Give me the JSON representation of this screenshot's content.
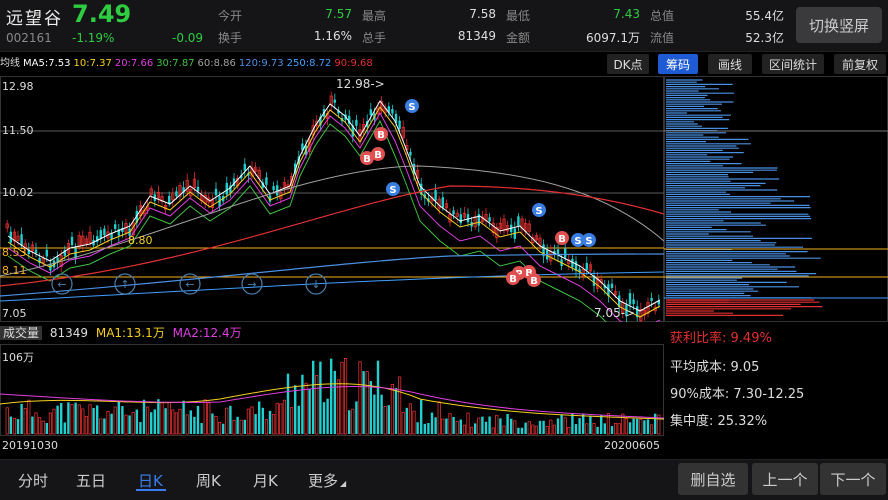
{
  "stock": {
    "name": "远望谷",
    "price": "7.49",
    "code": "002161",
    "change_pct": "-1.19%",
    "change": "-0.09"
  },
  "quote": [
    {
      "label": "今开",
      "value": "7.57",
      "green": true
    },
    {
      "label": "最高",
      "value": "7.58",
      "green": false
    },
    {
      "label": "最低",
      "value": "7.43",
      "green": true
    },
    {
      "label": "总值",
      "value": "55.4亿",
      "green": false
    },
    {
      "label": "换手",
      "value": "1.16%",
      "green": false
    },
    {
      "label": "总手",
      "value": "81349",
      "green": false
    },
    {
      "label": "金额",
      "value": "6097.1万",
      "green": false
    },
    {
      "label": "流值",
      "value": "52.3亿",
      "green": false
    }
  ],
  "switch_label": "切换竖屏",
  "ma": {
    "title": "均线",
    "items": [
      {
        "text": "MA5:7.53",
        "color": "#ffffff"
      },
      {
        "text": "10:7.37",
        "color": "#f5d020"
      },
      {
        "text": "20:7.66",
        "color": "#e040e0"
      },
      {
        "text": "30:7.87",
        "color": "#40c040"
      },
      {
        "text": "60:8.86",
        "color": "#a0a0a0"
      },
      {
        "text": "120:9.73",
        "color": "#4a90e2"
      },
      {
        "text": "250:8.72",
        "color": "#40a0ff"
      },
      {
        "text": "90:9.68",
        "color": "#e03030"
      }
    ]
  },
  "tools": [
    "DK点",
    "筹码",
    "画线",
    "区间统计",
    "前复权"
  ],
  "price_axis": [
    "12.98",
    "11.50",
    "10.02",
    "8.53",
    "8.11",
    "7.05"
  ],
  "annotations": {
    "high": "12.98->",
    "low": "7.05->",
    "line_880": "8.80"
  },
  "volume": {
    "title": "成交量",
    "value": "81349",
    "ma1": "MA1:13.1万",
    "ma2": "MA2:12.4万",
    "max": "106万"
  },
  "dates": {
    "start": "20191030",
    "end": "20200605"
  },
  "chips": {
    "profit_label": "获利比率:",
    "profit_value": "9.49%",
    "avg_cost": "平均成本: 9.05",
    "cost90": "90%成本: 7.30-12.25",
    "concentration": "集中度: 25.32%"
  },
  "bottom_tabs": [
    "分时",
    "五日",
    "日K",
    "周K",
    "月K",
    "更多"
  ],
  "active_tab": 2,
  "bottom_buttons": [
    "删自选",
    "上一个",
    "下一个"
  ],
  "colors": {
    "up": "#e03030",
    "down": "#20d0d0",
    "green": "#2ecc40",
    "accent": "#1e5ad4"
  }
}
